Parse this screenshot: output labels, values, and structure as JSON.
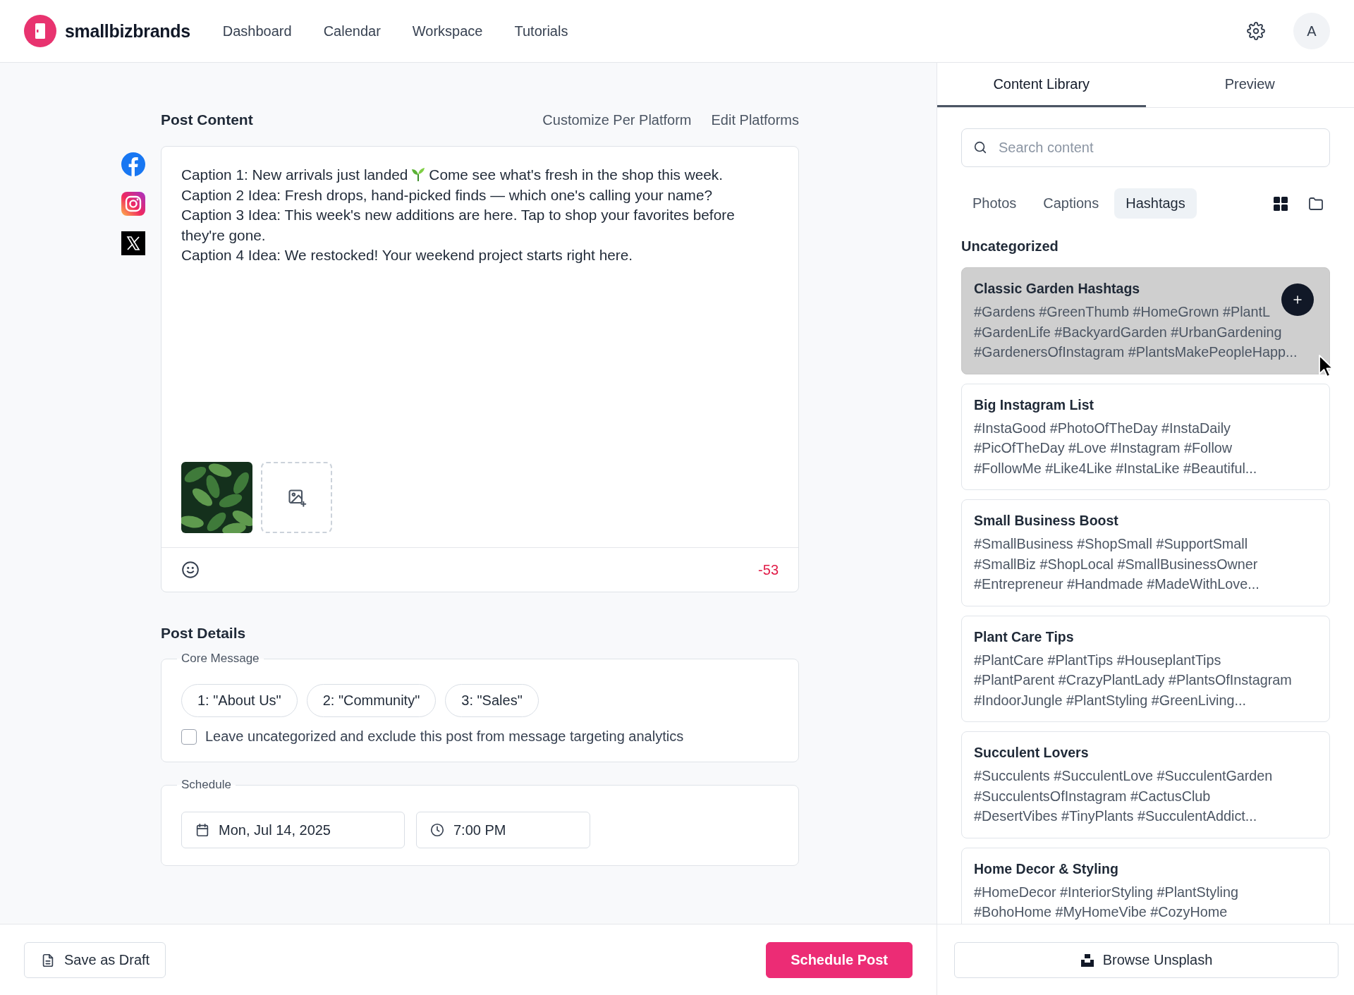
{
  "app": {
    "brand": "smallbizbrands",
    "avatar": "A"
  },
  "nav": [
    {
      "label": "Dashboard"
    },
    {
      "label": "Calendar"
    },
    {
      "label": "Workspace"
    },
    {
      "label": "Tutorials"
    }
  ],
  "post_content": {
    "title": "Post Content",
    "actions": [
      "Customize Per Platform",
      "Edit Platforms"
    ],
    "platforms": [
      {
        "kind": "facebook"
      },
      {
        "kind": "instagram"
      },
      {
        "kind": "x"
      }
    ],
    "caption_lines": [
      {
        "segments": [
          {
            "kind": "text",
            "text": "Caption 1: New arrivals just landed"
          },
          {
            "kind": "sprout"
          },
          {
            "kind": "text",
            "text": "Come see what's fresh in the shop this week."
          }
        ]
      },
      {
        "segments": [
          {
            "kind": "text",
            "text": "Caption 2 Idea: Fresh drops, hand-picked finds — which one's calling your name?"
          }
        ]
      },
      {
        "segments": [
          {
            "kind": "text",
            "text": "Caption 3 Idea: This week's new additions are here. Tap to shop your favorites before"
          }
        ]
      },
      {
        "segments": [
          {
            "kind": "text",
            "text": "they're gone."
          }
        ]
      },
      {
        "segments": [
          {
            "kind": "text",
            "text": "Caption 4 Idea: We restocked! Your weekend project starts right here."
          }
        ]
      }
    ],
    "media": [
      {
        "kind": "picture"
      }
    ],
    "char_count": "-53"
  },
  "post_details": {
    "title": "Post Details",
    "core_message": {
      "legend": "Core Message",
      "options": [
        {
          "label": "1: \"About Us\"",
          "selected": false
        },
        {
          "label": "2: \"Community\"",
          "selected": false
        },
        {
          "label": "3: \"Sales\"",
          "selected": false
        }
      ],
      "exclude": {
        "label": "Leave uncategorized and exclude this post from message targeting analytics",
        "checked": false
      }
    },
    "schedule": {
      "legend": "Schedule",
      "date": "Mon, Jul 14, 2025",
      "time": "7:00 PM"
    }
  },
  "library": {
    "tabs": [
      {
        "label": "Content Library",
        "selected": true
      },
      {
        "label": "Preview",
        "selected": false
      }
    ],
    "search": {
      "placeholder": "Search content"
    },
    "filters": [
      {
        "label": "Photos",
        "selected": false
      },
      {
        "label": "Captions",
        "selected": false
      },
      {
        "label": "Hashtags",
        "selected": true
      }
    ],
    "section": "Uncategorized",
    "cards": [
      {
        "title": "Classic Garden Hashtags",
        "tags": [
          "#Gardens #GreenThumb #HomeGrown #PlantL",
          "#GardenLife #BackyardGarden #UrbanGardening",
          "#GardenersOfInstagram #PlantsMakePeopleHapp..."
        ],
        "hovered": true
      },
      {
        "title": "Big Instagram List",
        "tags": [
          "#InstaGood #PhotoOfTheDay #InstaDaily",
          "#PicOfTheDay #Love #Instagram #Follow",
          "#FollowMe #Like4Like #InstaLike #Beautiful..."
        ],
        "hovered": false
      },
      {
        "title": "Small Business Boost",
        "tags": [
          "#SmallBusiness #ShopSmall #SupportSmall",
          "#SmallBiz #ShopLocal #SmallBusinessOwner",
          "#Entrepreneur #Handmade #MadeWithLove..."
        ],
        "hovered": false
      },
      {
        "title": "Plant Care Tips",
        "tags": [
          "#PlantCare #PlantTips #HouseplantTips",
          "#PlantParent #CrazyPlantLady #PlantsOfInstagram",
          "#IndoorJungle #PlantStyling #GreenLiving..."
        ],
        "hovered": false
      },
      {
        "title": "Succulent Lovers",
        "tags": [
          "#Succulents #SucculentLove #SucculentGarden",
          "#SucculentsOfInstagram #CactusClub",
          "#DesertVibes #TinyPlants #SucculentAddict..."
        ],
        "hovered": false
      },
      {
        "title": "Home Decor & Styling",
        "tags": [
          "#HomeDecor #InteriorStyling #PlantStyling",
          "#BohoHome #MyHomeVibe #CozyHome"
        ],
        "hovered": false
      }
    ]
  },
  "footer": {
    "draft": "Save as Draft",
    "schedule": "Schedule Post",
    "unsplash": "Browse Unsplash"
  }
}
